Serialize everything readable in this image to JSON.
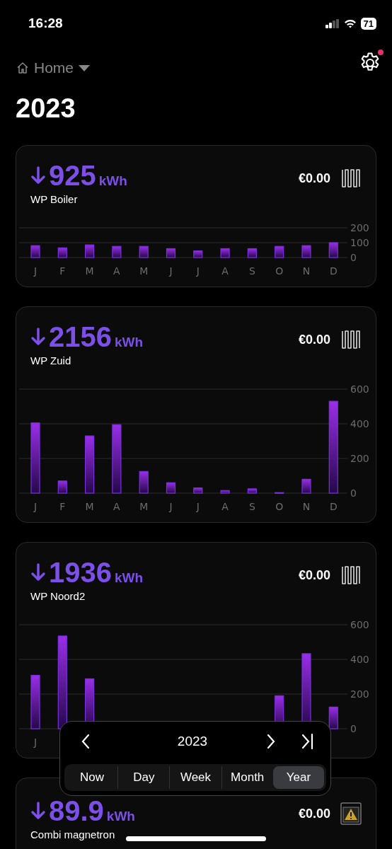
{
  "status_bar": {
    "time": "16:28",
    "battery": "71"
  },
  "header": {
    "location": "Home",
    "settings_badge": true
  },
  "title": "2023",
  "cards": [
    {
      "value": "925",
      "unit": "kWh",
      "name": "WP Boiler",
      "price": "€0.00",
      "kind": "heater",
      "chart_data": {
        "type": "bar",
        "categories": [
          "J",
          "F",
          "M",
          "A",
          "M",
          "J",
          "J",
          "A",
          "S",
          "O",
          "N",
          "D"
        ],
        "values": [
          80,
          65,
          85,
          75,
          75,
          60,
          45,
          60,
          60,
          75,
          80,
          100
        ],
        "ylim": [
          0,
          200
        ],
        "yticks": [
          0,
          100,
          200
        ]
      }
    },
    {
      "value": "2156",
      "unit": "kWh",
      "name": "WP Zuid",
      "price": "€0.00",
      "kind": "heater",
      "chart_data": {
        "type": "bar",
        "categories": [
          "J",
          "F",
          "M",
          "A",
          "M",
          "J",
          "J",
          "A",
          "S",
          "O",
          "N",
          "D"
        ],
        "values": [
          405,
          70,
          330,
          395,
          125,
          60,
          30,
          15,
          25,
          3,
          80,
          530
        ],
        "ylim": [
          0,
          600
        ],
        "yticks": [
          0,
          200,
          400,
          600
        ]
      }
    },
    {
      "value": "1936",
      "unit": "kWh",
      "name": "WP Noord2",
      "price": "€0.00",
      "kind": "heater",
      "chart_data": {
        "type": "bar",
        "categories": [
          "J",
          null,
          null,
          null,
          null,
          null,
          null,
          null,
          null,
          null,
          null,
          null
        ],
        "values": [
          308,
          535,
          288,
          null,
          null,
          null,
          null,
          null,
          null,
          190,
          433,
          125
        ],
        "ylim": [
          0,
          600
        ],
        "yticks": [
          0,
          200,
          400,
          600
        ]
      }
    },
    {
      "value": "89.9",
      "unit": "kWh",
      "name": "Combi magnetron",
      "price": "€0.00",
      "kind": "appliance"
    }
  ],
  "period_picker": {
    "label": "2023",
    "tabs": [
      {
        "label": "Now",
        "selected": false
      },
      {
        "label": "Day",
        "selected": false
      },
      {
        "label": "Week",
        "selected": false
      },
      {
        "label": "Month",
        "selected": false
      },
      {
        "label": "Year",
        "selected": true
      }
    ]
  }
}
